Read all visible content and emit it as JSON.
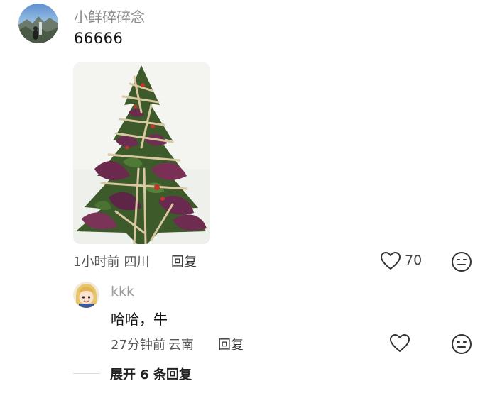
{
  "comment": {
    "username": "小鲜碎碎念",
    "text": "66666",
    "time": "1小时前",
    "location": "四川",
    "reply_label": "回复",
    "like_count": "70",
    "avatar_icon": "mountain-waterfall-avatar",
    "image_icon": "spinach-christmas-tree-photo"
  },
  "reply": {
    "username": "kkk",
    "text": "哈哈，牛",
    "time": "27分钟前",
    "location": "云南",
    "reply_label": "回复",
    "avatar_icon": "cartoon-girl-avatar"
  },
  "expand": {
    "label": "展开 6 条回复"
  },
  "colors": {
    "secondary_text": "#8a8a8a",
    "icon_stroke": "#333333"
  }
}
